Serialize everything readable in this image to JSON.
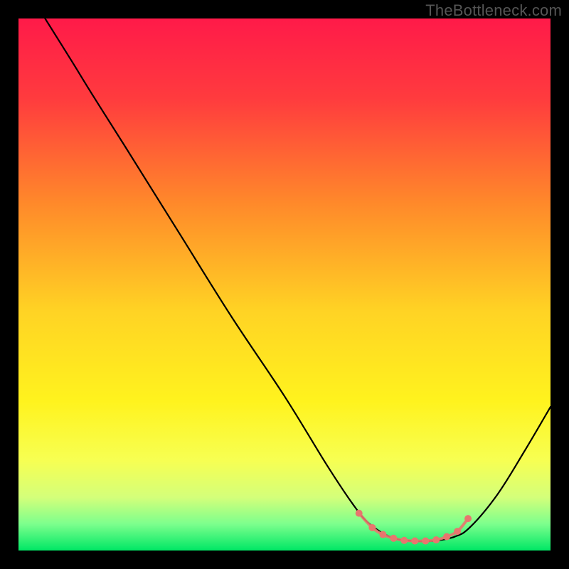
{
  "watermark": "TheBottleneck.com",
  "chart_data": {
    "type": "line",
    "title": "",
    "xlabel": "",
    "ylabel": "",
    "xlim": [
      0,
      100
    ],
    "ylim": [
      0,
      100
    ],
    "grid": false,
    "legend": false,
    "background_gradient_stops": [
      {
        "offset": 0.0,
        "color": "#ff1a49"
      },
      {
        "offset": 0.15,
        "color": "#ff3b3e"
      },
      {
        "offset": 0.35,
        "color": "#ff8a2a"
      },
      {
        "offset": 0.55,
        "color": "#ffd324"
      },
      {
        "offset": 0.72,
        "color": "#fff31e"
      },
      {
        "offset": 0.83,
        "color": "#f7ff52"
      },
      {
        "offset": 0.9,
        "color": "#d4ff7a"
      },
      {
        "offset": 0.95,
        "color": "#7dff8d"
      },
      {
        "offset": 1.0,
        "color": "#00e765"
      }
    ],
    "series": [
      {
        "name": "bottleneck-curve",
        "stroke": "#000000",
        "stroke_width": 2.2,
        "points": [
          {
            "x": 5.0,
            "y": 100.0
          },
          {
            "x": 10.0,
            "y": 92.0
          },
          {
            "x": 14.0,
            "y": 85.5
          },
          {
            "x": 20.0,
            "y": 76.0
          },
          {
            "x": 30.0,
            "y": 60.0
          },
          {
            "x": 40.0,
            "y": 44.0
          },
          {
            "x": 50.0,
            "y": 29.0
          },
          {
            "x": 58.0,
            "y": 16.0
          },
          {
            "x": 63.0,
            "y": 8.5
          },
          {
            "x": 66.0,
            "y": 5.0
          },
          {
            "x": 70.0,
            "y": 2.5
          },
          {
            "x": 74.0,
            "y": 1.8
          },
          {
            "x": 78.0,
            "y": 1.8
          },
          {
            "x": 82.0,
            "y": 2.6
          },
          {
            "x": 85.0,
            "y": 4.5
          },
          {
            "x": 90.0,
            "y": 10.5
          },
          {
            "x": 95.0,
            "y": 18.5
          },
          {
            "x": 100.0,
            "y": 27.0
          }
        ]
      },
      {
        "name": "valley-highlight-dots",
        "stroke": "#e8766e",
        "marker_radius": 5,
        "points": [
          {
            "x": 64.0,
            "y": 7.0
          },
          {
            "x": 66.5,
            "y": 4.3
          },
          {
            "x": 68.5,
            "y": 3.0
          },
          {
            "x": 70.5,
            "y": 2.3
          },
          {
            "x": 72.5,
            "y": 1.9
          },
          {
            "x": 74.5,
            "y": 1.8
          },
          {
            "x": 76.5,
            "y": 1.8
          },
          {
            "x": 78.5,
            "y": 2.0
          },
          {
            "x": 80.5,
            "y": 2.6
          },
          {
            "x": 82.5,
            "y": 3.6
          },
          {
            "x": 84.5,
            "y": 6.0
          }
        ]
      }
    ]
  }
}
